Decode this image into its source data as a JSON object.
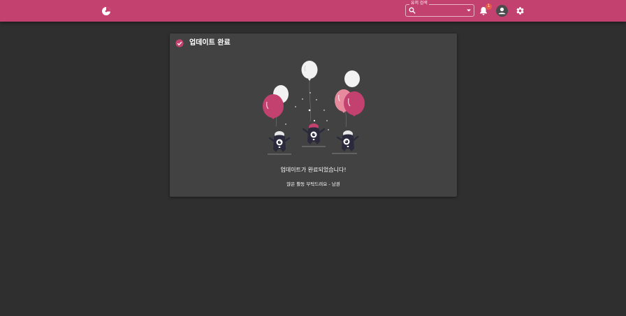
{
  "header": {
    "logo_icon": "pie-chart-logo",
    "search": {
      "legend": "유저 검색",
      "value": "",
      "icon": "search-icon",
      "dropdown_icon": "arrow-drop-down-icon"
    },
    "notifications": {
      "icon": "bell-icon",
      "count": "1"
    },
    "avatar_icon": "account-icon",
    "settings_icon": "gear-icon",
    "bar_color": "#c2416f",
    "badge_color": "#e55b4a"
  },
  "card": {
    "icon": "check-circle-icon",
    "title": "업데이트 완료",
    "message": "업데이트가 완료되었습니다!",
    "submessage": "많은 활동 부탁드려요 - 남권",
    "accent_color": "#c2416f",
    "background_color": "#424242"
  },
  "page": {
    "background_color": "#2f2f2f"
  }
}
